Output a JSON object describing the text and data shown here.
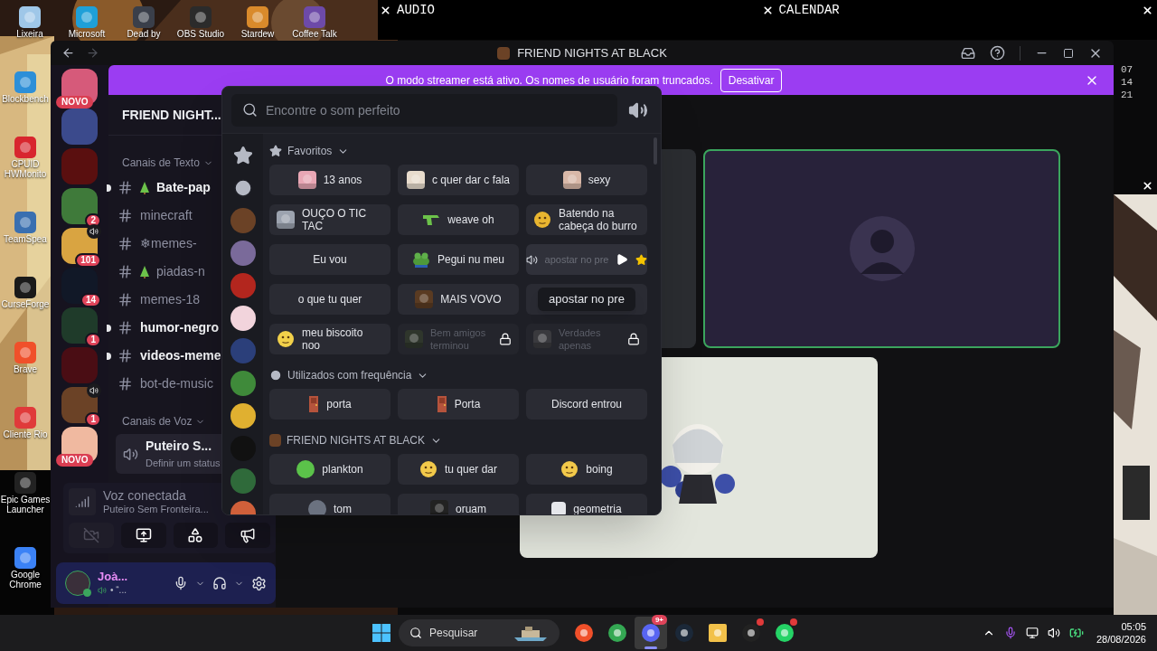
{
  "desktop": {
    "widgets": [
      {
        "title": "AUDIO"
      },
      {
        "title": "CALENDAR"
      }
    ],
    "top_shortcuts": [
      {
        "label": "Lixeira"
      },
      {
        "label": "Microsoft"
      },
      {
        "label": "Dead by"
      },
      {
        "label": "OBS Studio"
      },
      {
        "label": "Stardew"
      },
      {
        "label": "Coffee Talk"
      }
    ],
    "side_shortcuts": [
      {
        "label": "Blockbench"
      },
      {
        "label": "CPUID HWMonito"
      },
      {
        "label": "TeamSpea"
      },
      {
        "label": "CurseForge"
      },
      {
        "label": "Brave"
      },
      {
        "label": "Cliente Rio"
      },
      {
        "label": "Epic Games Launcher"
      },
      {
        "label": "Google Chrome"
      }
    ],
    "calendar_days": [
      "07",
      "14",
      "21"
    ]
  },
  "window": {
    "title": "FRIEND NIGHTS AT BLACK"
  },
  "banner": {
    "text": "O modo streamer está ativo. Os nomes de usuário foram truncados.",
    "button": "Desativar"
  },
  "servers": [
    {
      "color": "#d65a7a",
      "kind": "new",
      "badge": "NOVO",
      "speaking": false
    },
    {
      "color": "#3b4a8c",
      "kind": "plain",
      "speaking": false
    },
    {
      "color": "#5a0f0f",
      "kind": "plain",
      "speaking": false
    },
    {
      "color": "#3f7a3a",
      "kind": "count",
      "badge": "2",
      "speaking": false
    },
    {
      "color": "#d9a441",
      "kind": "count",
      "badge": "101",
      "speaking": true
    },
    {
      "color": "#111827",
      "kind": "count",
      "badge": "14",
      "speaking": false
    },
    {
      "color": "#1f3b2a",
      "kind": "count",
      "badge": "1",
      "speaking": false
    },
    {
      "color": "#4a0d14",
      "kind": "plain",
      "speaking": false
    },
    {
      "color": "#6b4226",
      "kind": "count",
      "badge": "1",
      "speaking": true
    },
    {
      "color": "#f0b9a0",
      "kind": "new",
      "badge": "NOVO",
      "speaking": false
    }
  ],
  "sidebar": {
    "server_name": "FRIEND NIGHT...",
    "text_category": "Canais de Texto",
    "channels": [
      {
        "kind": "tree",
        "name": "Bate-pap",
        "unread": true
      },
      {
        "kind": "plain",
        "name": "minecraft",
        "unread": false
      },
      {
        "kind": "plain",
        "name": "❄memes-",
        "unread": false
      },
      {
        "kind": "tree",
        "name": "piadas-n",
        "unread": false
      },
      {
        "kind": "plain",
        "name": "memes-18",
        "unread": false
      },
      {
        "kind": "plain",
        "name": "humor-negro",
        "unread": true
      },
      {
        "kind": "plain",
        "name": "videos-meme",
        "unread": true
      },
      {
        "kind": "plain",
        "name": "bot-de-music",
        "unread": false
      }
    ],
    "voice_category": "Canais de Voz",
    "voice_channel": {
      "name": "Puteiro S...",
      "status": "Definir um status"
    }
  },
  "voice_connection": {
    "title": "Voz conectada",
    "channel": "Puteiro Sem Fronteira..."
  },
  "call_buttons": [
    {
      "kind": "camera",
      "disabled": true
    },
    {
      "kind": "screen",
      "disabled": false
    },
    {
      "kind": "activities",
      "disabled": false
    },
    {
      "kind": "soundboard",
      "disabled": false
    }
  ],
  "user": {
    "name": "Joà...",
    "status": "• “..."
  },
  "soundboard": {
    "search": {
      "placeholder": "Encontre o som perfeito"
    },
    "categories": [
      {
        "kind": "star"
      },
      {
        "kind": "clock"
      },
      {
        "kind": "server",
        "color": "#6b4226"
      },
      {
        "kind": "server",
        "color": "#7a6a9a"
      },
      {
        "kind": "server",
        "color": "#b3261e"
      },
      {
        "kind": "server",
        "color": "#f2d4dc"
      },
      {
        "kind": "server",
        "color": "#2b3f7a"
      },
      {
        "kind": "server",
        "color": "#3f8a3a"
      },
      {
        "kind": "server",
        "color": "#e0b030"
      },
      {
        "kind": "server",
        "color": "#111111"
      },
      {
        "kind": "server",
        "color": "#2f6a3a"
      },
      {
        "kind": "server",
        "color": "#d0603a"
      }
    ],
    "sections": [
      {
        "kind": "star",
        "title": "Favoritos",
        "sounds": [
          {
            "kind": "normal",
            "label": "13 anos",
            "thumb": {
              "kind": "picture",
              "color": "#e9a7b5"
            }
          },
          {
            "kind": "normal",
            "label": "c quer dar c fala",
            "thumb": {
              "kind": "picture",
              "color": "#e8dccd"
            }
          },
          {
            "kind": "normal",
            "label": "sexy",
            "thumb": {
              "kind": "picture",
              "color": "#d9b8a8"
            }
          },
          {
            "kind": "normal",
            "label": "OUÇO O TIC TAC",
            "thumb": {
              "kind": "picture",
              "color": "#9ca3af"
            }
          },
          {
            "kind": "normal",
            "label": "weave oh",
            "thumb": {
              "kind": "gun"
            }
          },
          {
            "kind": "normal",
            "label": "Batendo na cabeça do burro",
            "thumb": {
              "kind": "emoji",
              "color": "#e8b530"
            }
          },
          {
            "kind": "normal",
            "label": "Eu vou"
          },
          {
            "kind": "normal",
            "label": "Pegui nu meu",
            "thumb": {
              "kind": "frog"
            }
          },
          {
            "kind": "hover",
            "label": "apostar no pre"
          },
          {
            "kind": "normal",
            "label": "o que tu quer"
          },
          {
            "kind": "normal",
            "label": "MAIS VOVO",
            "thumb": {
              "kind": "picture",
              "color": "#5a3b22"
            }
          },
          {
            "kind": "tooltip",
            "label": "apostar no pre"
          },
          {
            "kind": "normal",
            "label": "meu biscoito noo",
            "thumb": {
              "kind": "emoji",
              "color": "#f2d14a"
            }
          },
          {
            "kind": "locked",
            "label": "Bem amigos terminou",
            "thumb": {
              "kind": "picture",
              "color": "#2f362c"
            }
          },
          {
            "kind": "locked",
            "label": "Verdades apenas",
            "thumb": {
              "kind": "picture",
              "color": "#3a3a3e"
            }
          }
        ]
      },
      {
        "kind": "clock",
        "title": "Utilizados com frequência",
        "sounds": [
          {
            "kind": "normal",
            "label": "porta",
            "thumb": {
              "kind": "door"
            }
          },
          {
            "kind": "normal",
            "label": "Porta",
            "thumb": {
              "kind": "door"
            }
          },
          {
            "kind": "normal",
            "label": "Discord entrou"
          }
        ]
      },
      {
        "kind": "server",
        "title": "FRIEND NIGHTS AT BLACK",
        "sounds": [
          {
            "kind": "normal",
            "label": "plankton",
            "thumb": {
              "kind": "dot",
              "color": "#5bc24a"
            }
          },
          {
            "kind": "normal",
            "label": "tu quer dar",
            "thumb": {
              "kind": "emoji",
              "color": "#f2c94a"
            }
          },
          {
            "kind": "normal",
            "label": "boing",
            "thumb": {
              "kind": "emoji",
              "color": "#f2c94a"
            }
          },
          {
            "kind": "normal",
            "label": "tom",
            "thumb": {
              "kind": "dot",
              "color": "#6b7280"
            }
          },
          {
            "kind": "normal",
            "label": "oruam",
            "thumb": {
              "kind": "picture",
              "color": "#222222"
            }
          },
          {
            "kind": "normal",
            "label": "geometria",
            "thumb": {
              "kind": "square",
              "color": "#e5e7eb"
            }
          }
        ]
      }
    ]
  },
  "call": {
    "tiles": [
      {
        "kind": "hidden"
      },
      {
        "kind": "avatar",
        "speaking": true
      },
      {
        "kind": "picture",
        "speaking": false
      }
    ]
  },
  "taskbar": {
    "search": "Pesquisar",
    "apps": [
      {
        "kind": "brave",
        "active": false
      },
      {
        "kind": "chrome",
        "active": false
      },
      {
        "kind": "discord",
        "active": true,
        "badge": "9+"
      },
      {
        "kind": "steam",
        "active": false
      },
      {
        "kind": "folder",
        "active": false
      },
      {
        "kind": "obs",
        "active": false,
        "dot": true
      },
      {
        "kind": "whatsapp",
        "active": false,
        "dot": true
      }
    ],
    "time": "05:05",
    "date": "28/08/2026"
  }
}
